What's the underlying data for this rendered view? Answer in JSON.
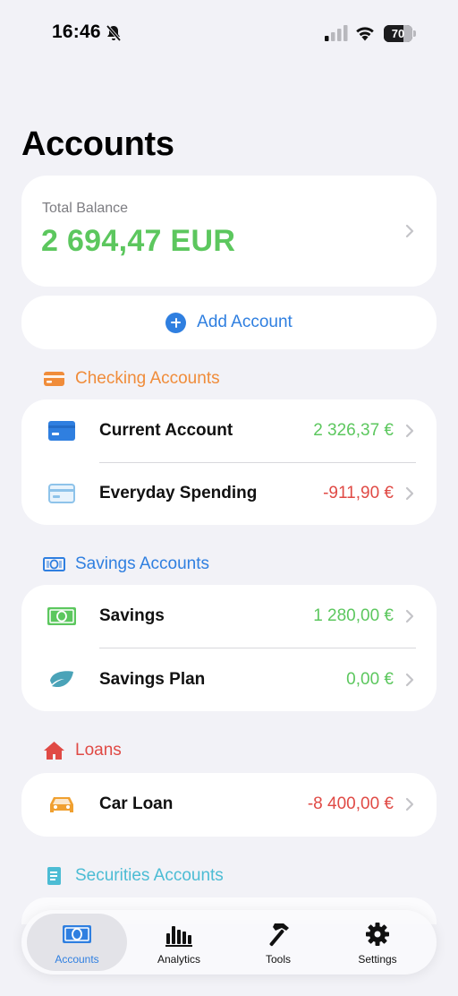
{
  "status_bar": {
    "time": "16:46",
    "battery": "70",
    "battery_fraction": 0.7
  },
  "page": {
    "title": "Accounts"
  },
  "total": {
    "label": "Total Balance",
    "value": "2 694,47 EUR"
  },
  "add_account": {
    "label": "Add Account"
  },
  "sections": {
    "checking": {
      "title": "Checking Accounts",
      "color": "#f08c3a",
      "rows": [
        {
          "label": "Current Account",
          "value": "2 326,37 €",
          "icon": "card-icon"
        },
        {
          "label": "Everyday Spending",
          "value": "-911,90 €",
          "icon": "card-outline-icon"
        }
      ]
    },
    "savings": {
      "title": "Savings Accounts",
      "color": "#2f7fe0",
      "rows": [
        {
          "label": "Savings",
          "value": "1 280,00 €",
          "icon": "banknote-icon"
        },
        {
          "label": "Savings Plan",
          "value": "0,00 €",
          "icon": "leaf-icon"
        }
      ]
    },
    "loans": {
      "title": "Loans",
      "color": "#e04a45",
      "rows": [
        {
          "label": "Car Loan",
          "value": "-8 400,00 €",
          "icon": "car-icon"
        }
      ]
    },
    "securities": {
      "title": "Securities Accounts",
      "color": "#4cbcd4"
    }
  },
  "tabs": [
    {
      "label": "Accounts",
      "icon": "banknote-icon",
      "active": true
    },
    {
      "label": "Analytics",
      "icon": "bar-chart-icon",
      "active": false
    },
    {
      "label": "Tools",
      "icon": "hammer-icon",
      "active": false
    },
    {
      "label": "Settings",
      "icon": "gear-icon",
      "active": false
    }
  ],
  "colors": {
    "positive": "#5cc75e",
    "negative": "#e04a45",
    "accent": "#2f7fe0",
    "background": "#f2f2f7"
  }
}
